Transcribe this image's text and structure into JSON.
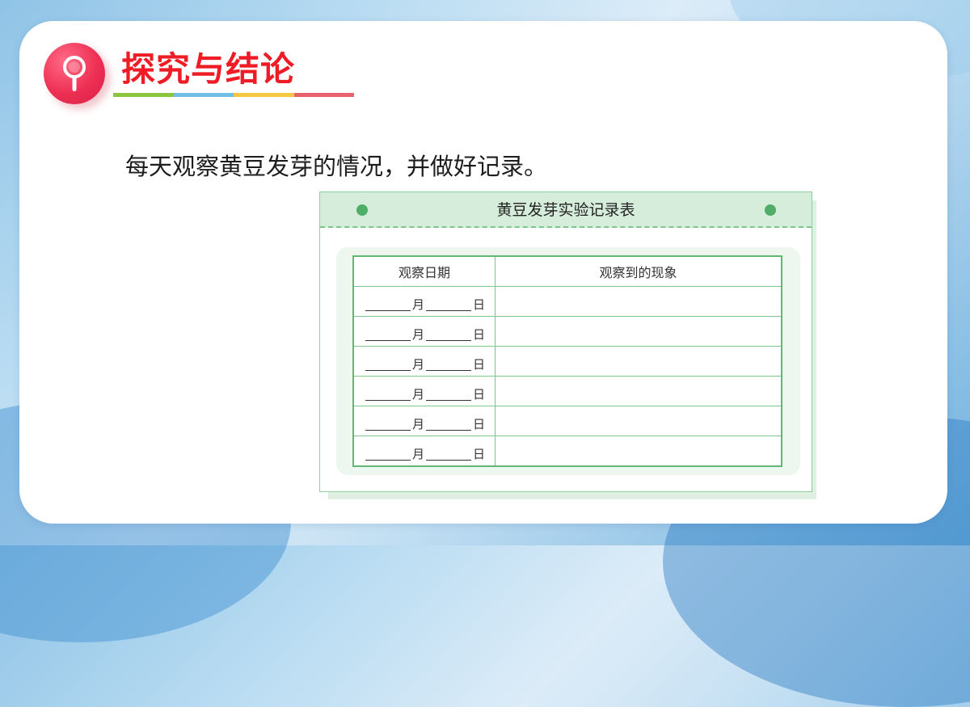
{
  "colors": {
    "accent": "#ee1c25",
    "heading_bar": [
      "#8cc63f",
      "#6ec1e4",
      "#f4c842",
      "#e8626d"
    ],
    "table_green": "#5fb874"
  },
  "icons": {
    "logo": "magnifier-icon"
  },
  "heading": {
    "text": "探究与结论"
  },
  "instruction": {
    "text": "每天观察黄豆发芽的情况，并做好记录。"
  },
  "record_sheet": {
    "title": "黄豆发芽实验记录表",
    "columns": [
      "观察日期",
      "观察到的现象"
    ],
    "month_unit": "月",
    "day_unit": "日",
    "rows": [
      {
        "observation": ""
      },
      {
        "observation": ""
      },
      {
        "observation": ""
      },
      {
        "observation": ""
      },
      {
        "observation": ""
      },
      {
        "observation": ""
      }
    ]
  }
}
